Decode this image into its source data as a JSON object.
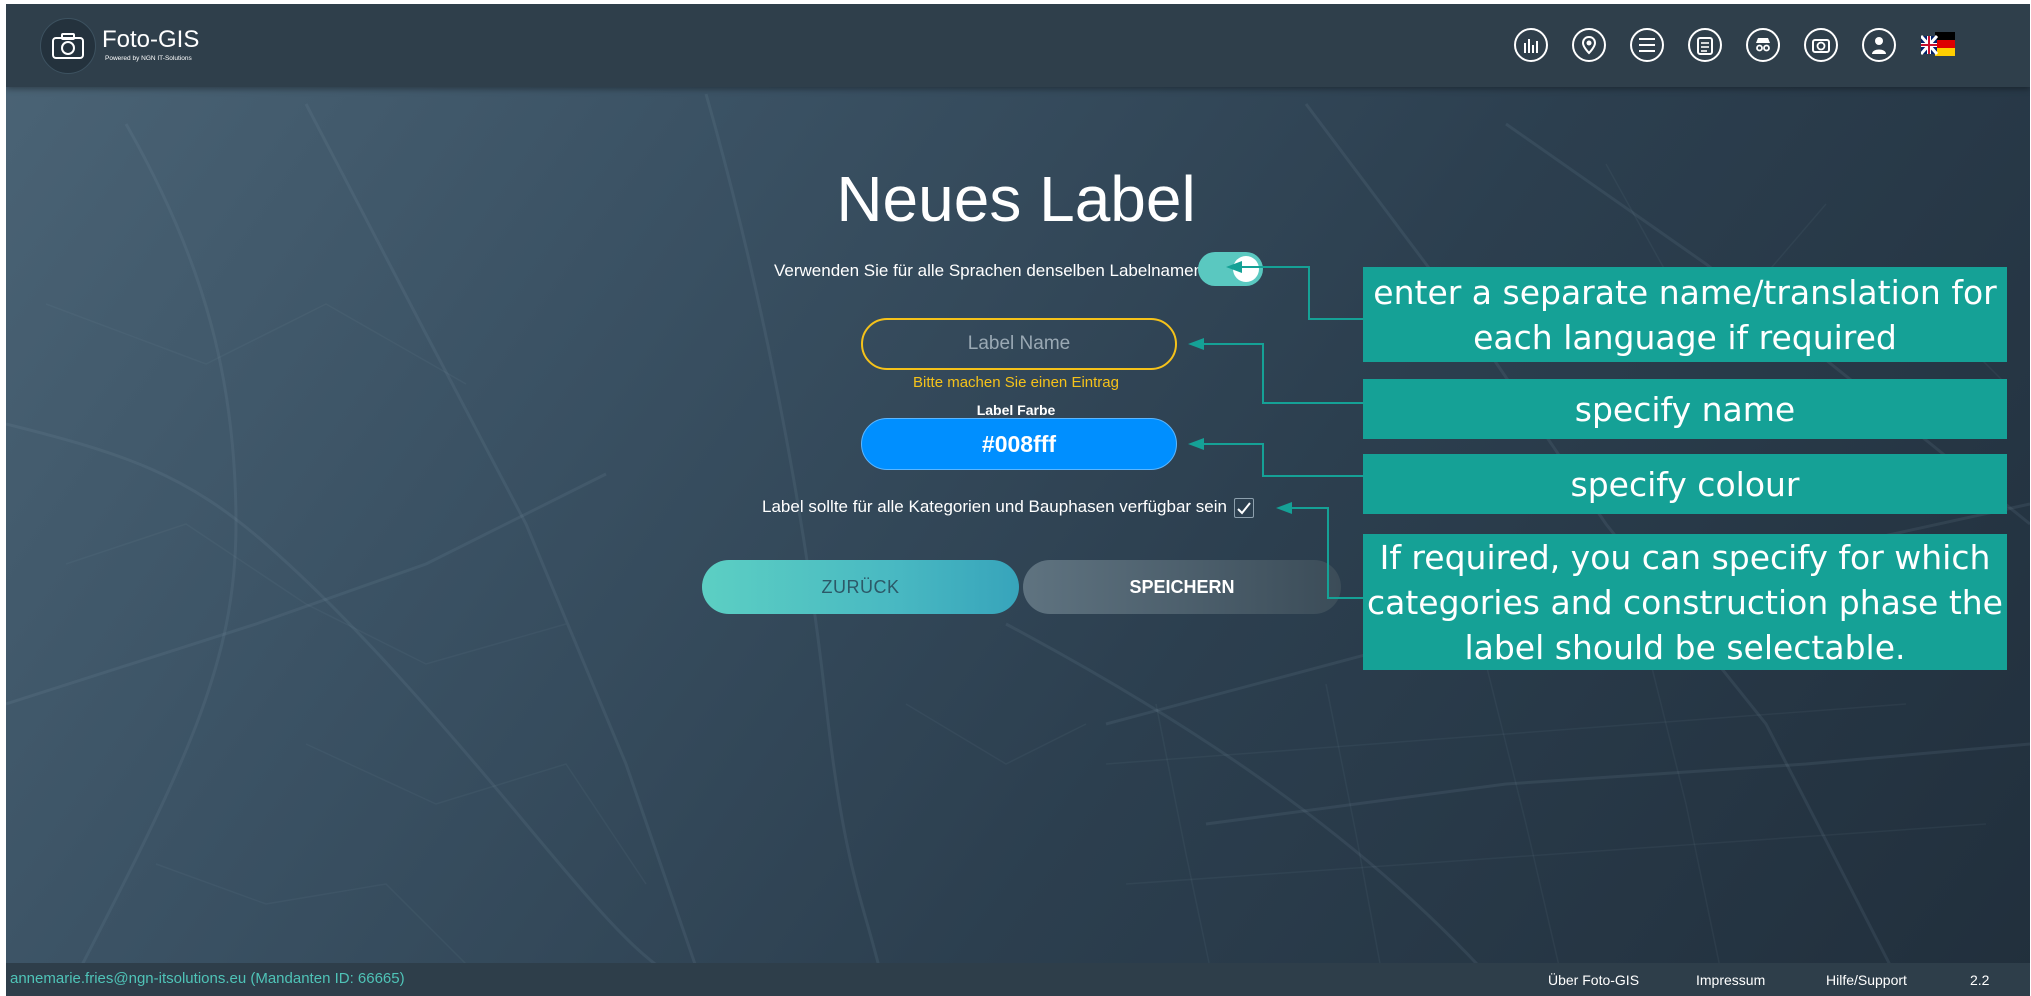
{
  "app": {
    "title": "Foto-GIS",
    "subtitle": "Powered by NGN IT-Solutions"
  },
  "nav_icons": [
    "bar-chart-icon",
    "map-pin-icon",
    "list-icon",
    "clipboard-icon",
    "incognito-user-icon",
    "camera-settings-icon",
    "user-icon",
    "language-flag-icon"
  ],
  "form": {
    "title": "Neues Label",
    "same_name_text": "Verwenden Sie für alle Sprachen denselben Labelnamen",
    "same_name_toggle_on": true,
    "label_name_placeholder": "Label Name",
    "label_name_value": "",
    "validation_message": "Bitte machen Sie einen Eintrag",
    "color_label": "Label Farbe",
    "color_value": "#008fff",
    "color_display": "#008fff",
    "all_categories_text": "Label sollte für alle Kategorien und Bauphasen verfügbar sein",
    "all_categories_checked": true,
    "back_label": "ZURÜCK",
    "save_label": "SPEICHERN"
  },
  "callouts": {
    "translation": "enter a separate name/translation for each language if required",
    "name": "specify name",
    "colour": "specify colour",
    "categories": "If required, you can specify for which categories and construction phase the label should be selectable."
  },
  "footer": {
    "user": "annemarie.fries@ngn-itsolutions.eu (Mandanten ID: 66665)",
    "about": "Über Foto-GIS",
    "imprint": "Impressum",
    "help": "Hilfe/Support",
    "version": "2.2"
  },
  "colors": {
    "accent_teal": "#15a196",
    "toggle_teal": "#5ac8c0",
    "warning_yellow": "#f5c21a",
    "label_color": "#008fff"
  }
}
